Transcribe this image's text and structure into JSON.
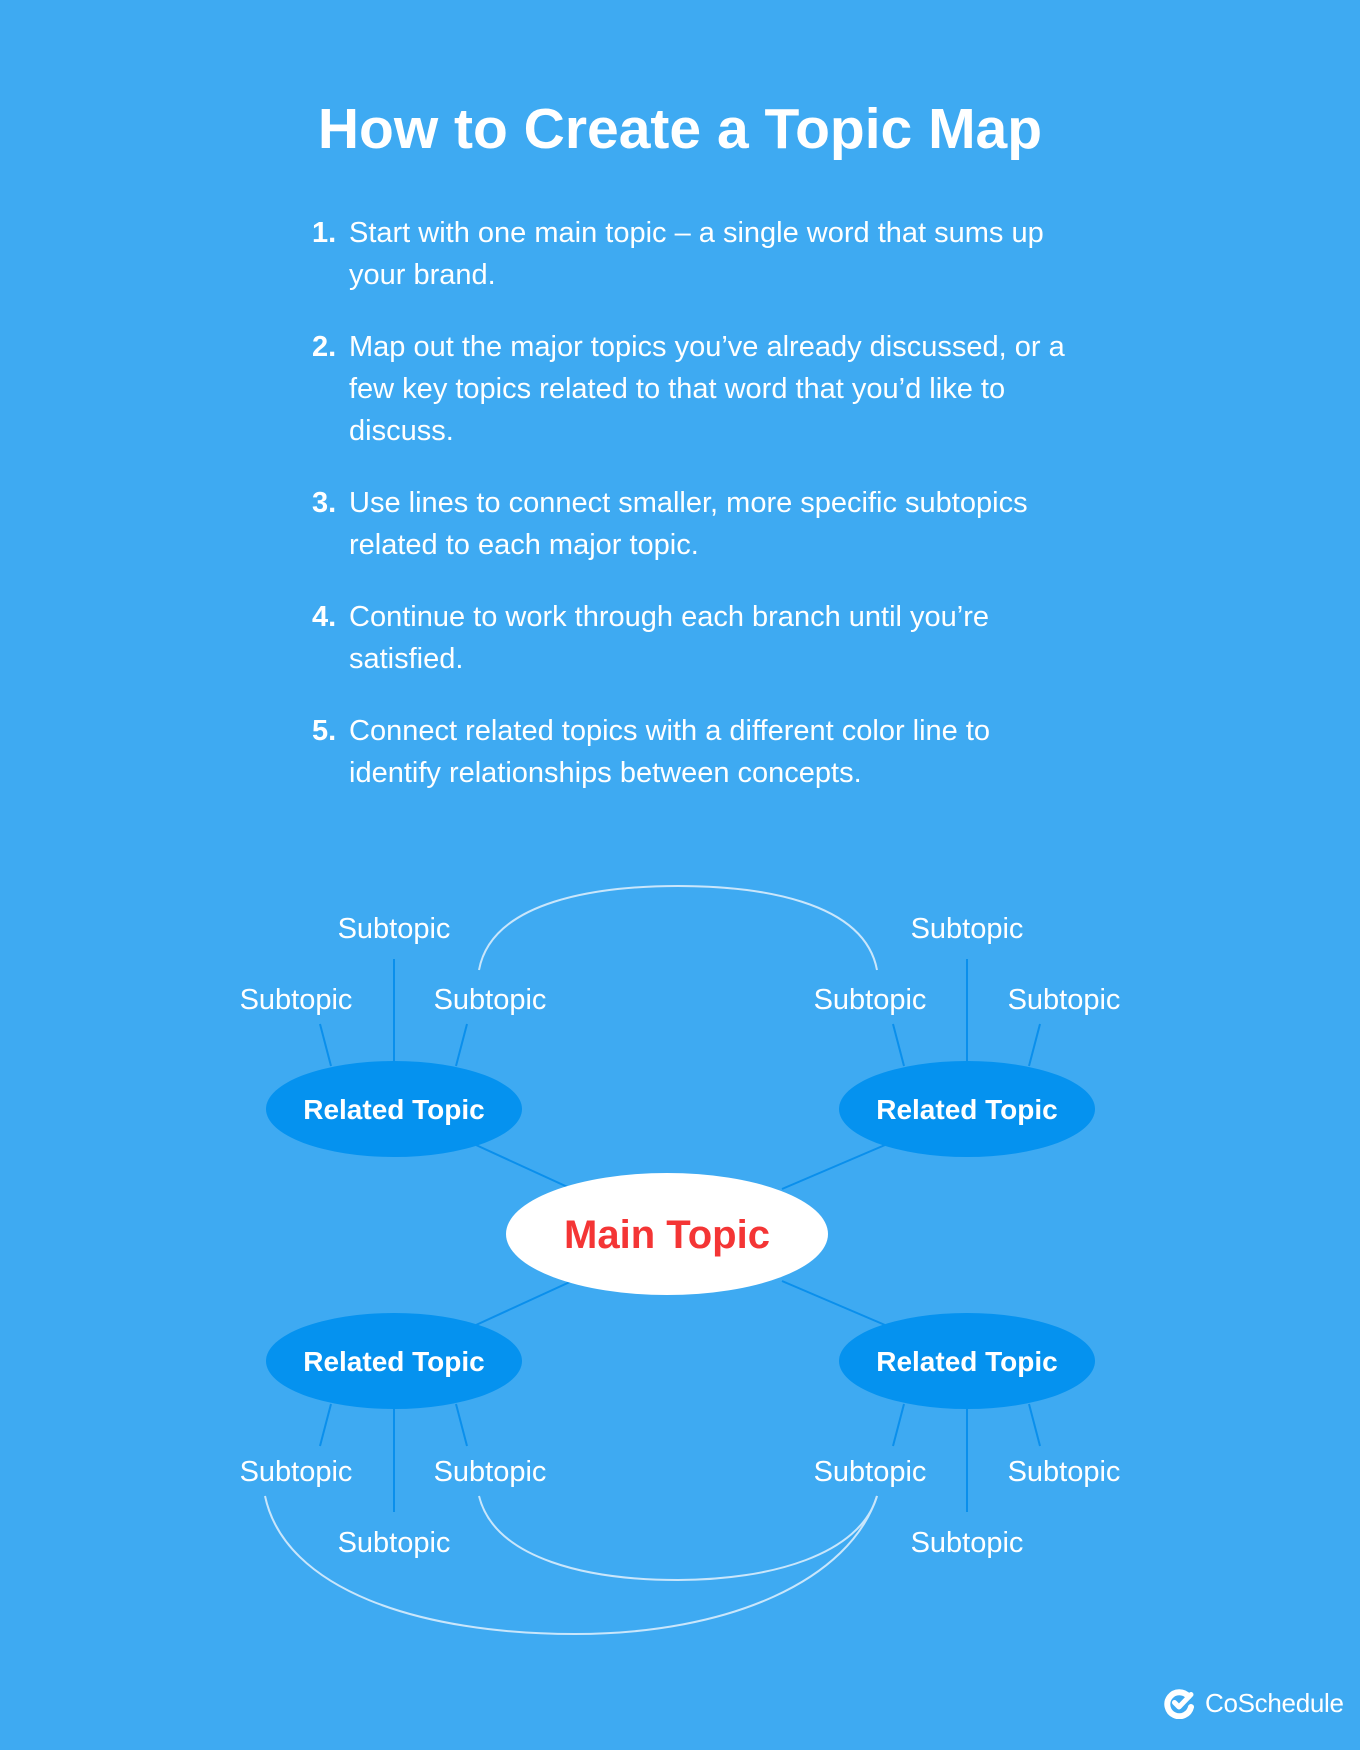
{
  "title": "How to Create a Topic Map",
  "steps": [
    {
      "number": "1.",
      "text": "Start with one main topic – a single word that sums up your brand."
    },
    {
      "number": "2.",
      "text": "Map out the major topics you’ve already discussed, or a few key topics related to that word that you’d like to discuss."
    },
    {
      "number": "3.",
      "text": "Use lines to connect smaller, more specific subtopics related to each major topic."
    },
    {
      "number": "4.",
      "text": "Continue to work through each branch until you’re satisfied."
    },
    {
      "number": "5.",
      "text": "Connect related topics with a different color line to identify relationships between concepts."
    }
  ],
  "diagram": {
    "main_topic": "Main Topic",
    "related_topics": [
      {
        "label": "Related Topic",
        "position": "top-left",
        "subtopics": [
          "Subtopic",
          "Subtopic",
          "Subtopic"
        ]
      },
      {
        "label": "Related Topic",
        "position": "top-right",
        "subtopics": [
          "Subtopic",
          "Subtopic",
          "Subtopic"
        ]
      },
      {
        "label": "Related Topic",
        "position": "bottom-left",
        "subtopics": [
          "Subtopic",
          "Subtopic",
          "Subtopic"
        ]
      },
      {
        "label": "Related Topic",
        "position": "bottom-right",
        "subtopics": [
          "Subtopic",
          "Subtopic",
          "Subtopic"
        ]
      }
    ],
    "relationships": [
      {
        "from": "top-left right subtopic",
        "to": "top-right left subtopic"
      },
      {
        "from": "bottom-left right subtopic",
        "to": "bottom-right left subtopic"
      },
      {
        "from": "bottom-left left subtopic",
        "to": "bottom-right left subtopic"
      }
    ]
  },
  "colors": {
    "background": "#3eaaf2",
    "related_fill": "#0592ef",
    "branch_line": "#0a8fec",
    "relation_line": "#c9e6fb",
    "main_fill": "#ffffff",
    "main_text": "#f43535",
    "text": "#ffffff"
  },
  "brand": {
    "name": "CoSchedule",
    "icon": "coschedule-check-icon"
  }
}
